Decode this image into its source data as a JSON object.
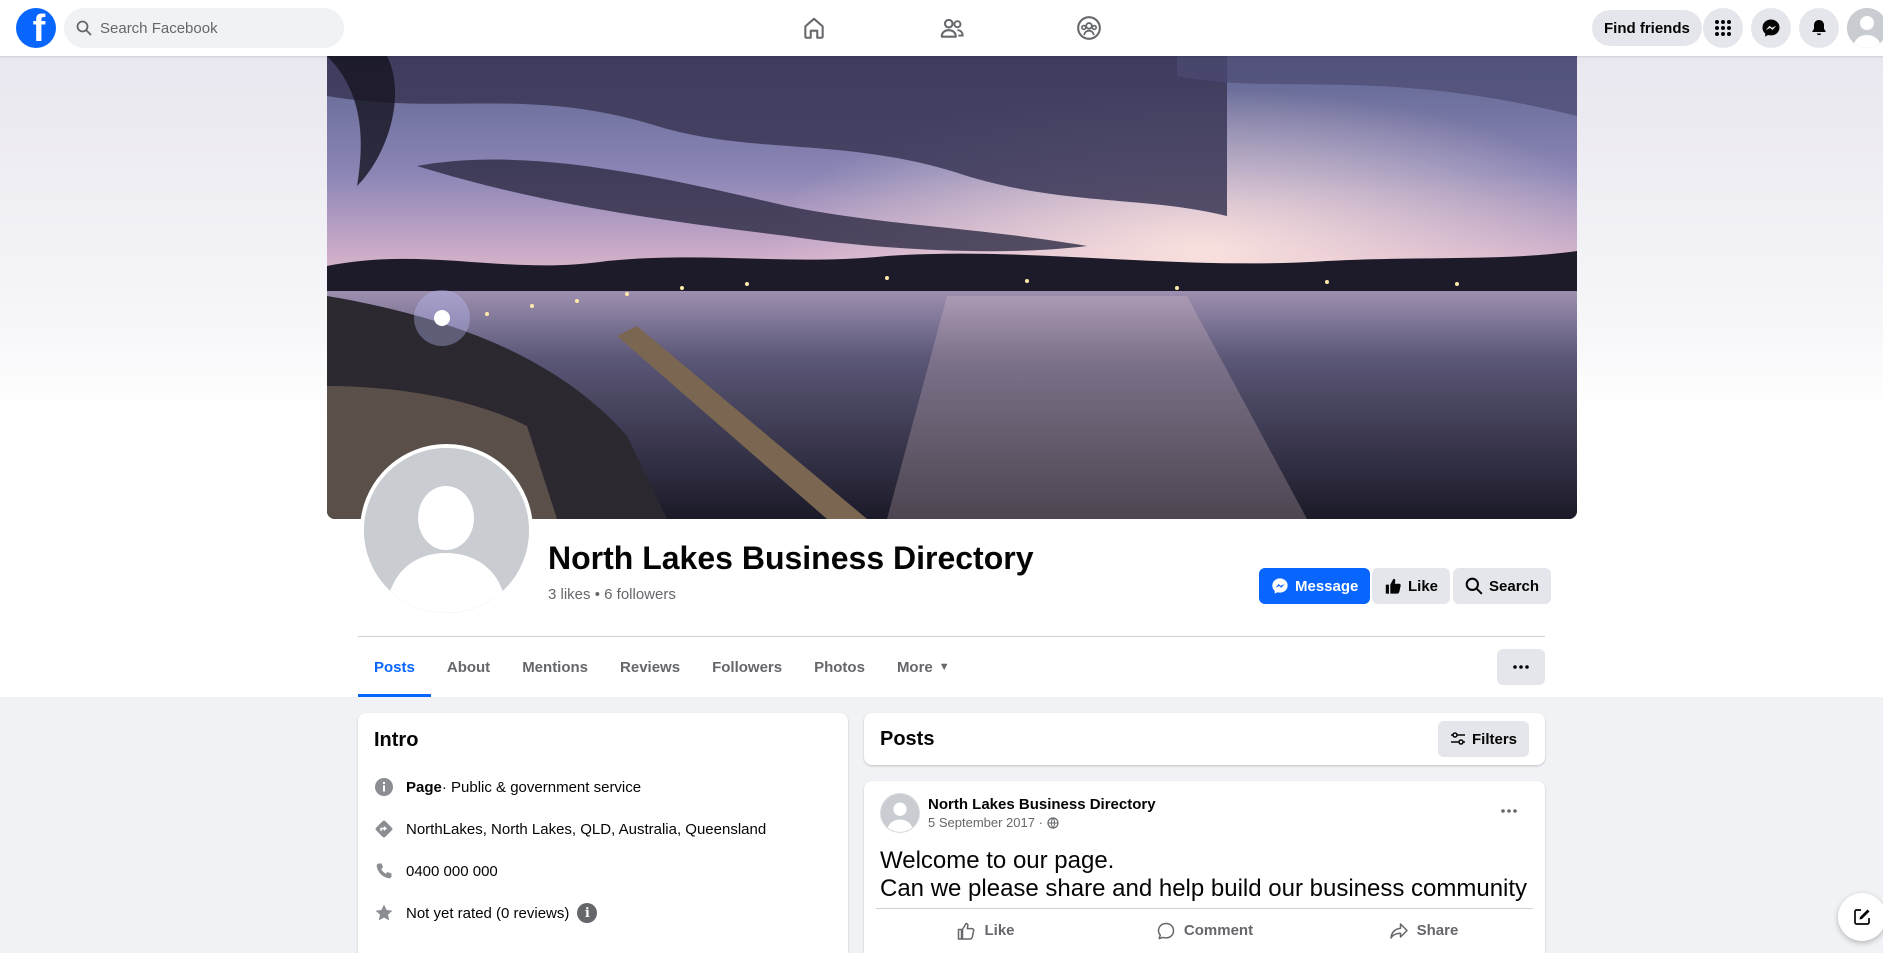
{
  "topbar": {
    "search_placeholder": "Search Facebook",
    "find_friends_label": "Find friends",
    "nav_icons": [
      "home-icon",
      "friends-icon",
      "groups-icon"
    ],
    "right_icons": [
      "menu-grid-icon",
      "messenger-icon",
      "bell-icon"
    ]
  },
  "profile": {
    "name": "North Lakes Business Directory",
    "likes": "3 likes",
    "separator": "•",
    "followers": "6 followers",
    "buttons": {
      "message": "Message",
      "like": "Like",
      "search": "Search"
    }
  },
  "tabs": [
    {
      "label": "Posts",
      "active": true
    },
    {
      "label": "About"
    },
    {
      "label": "Mentions"
    },
    {
      "label": "Reviews"
    },
    {
      "label": "Followers"
    },
    {
      "label": "Photos"
    },
    {
      "label": "More"
    }
  ],
  "intro": {
    "title": "Intro",
    "page_label": "Page",
    "category": " · Public & government service",
    "address": "NorthLakes, North Lakes, QLD, Australia, Queensland",
    "phone": "0400 000 000",
    "rating": "Not yet rated (0 reviews)"
  },
  "posts_section": {
    "title": "Posts",
    "filters_label": "Filters"
  },
  "post": {
    "author": "North Lakes Business Directory",
    "date": "5 September 2017 ·",
    "line1": "Welcome to our page.",
    "line2": "Can we please share and help build our business community",
    "actions": {
      "like": "Like",
      "comment": "Comment",
      "share": "Share"
    }
  },
  "colors": {
    "brand": "#0866ff",
    "secondary_text": "#65676b",
    "button_bg": "#e4e6eb"
  }
}
